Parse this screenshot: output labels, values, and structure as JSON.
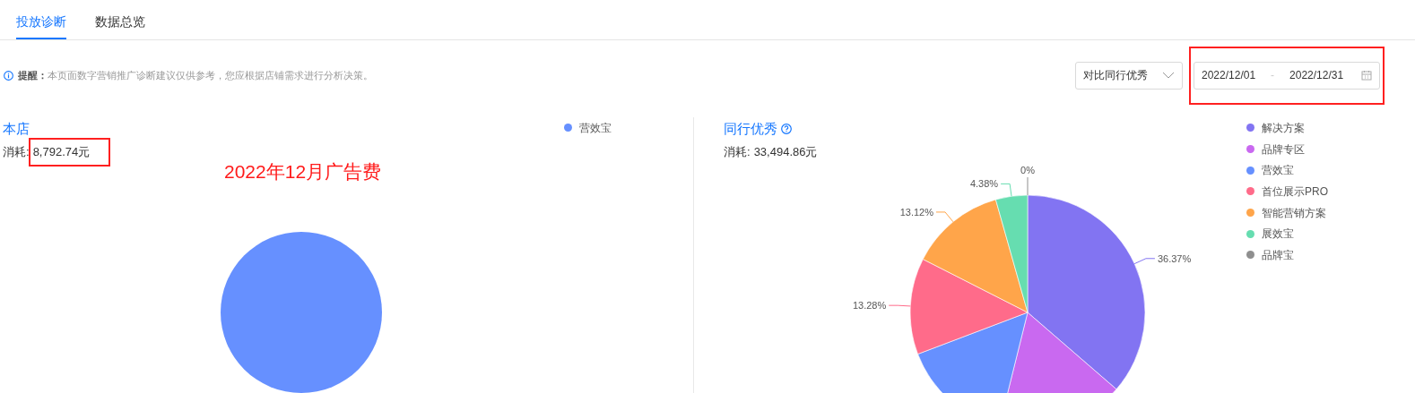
{
  "tabs": [
    {
      "label": "投放诊断",
      "selected": true
    },
    {
      "label": "数据总览",
      "selected": false
    }
  ],
  "notice": {
    "label": "提醒：",
    "text": "本页面数字营销推广诊断建议仅供参考，您应根据店铺需求进行分析决策。"
  },
  "compare_select": {
    "value": "对比同行优秀"
  },
  "date_range": {
    "start": "2022/12/01",
    "separator": "-",
    "end": "2022/12/31",
    "highlighted": true
  },
  "panels": [
    {
      "title": "本店",
      "spend": {
        "label": "消耗:",
        "value": "8,792.74元",
        "highlighted": true
      },
      "annotation": "2022年12月广告费",
      "chart_data": {
        "type": "pie",
        "categories": [
          "营效宝"
        ],
        "series": [
          {
            "color": "#6690ff",
            "values": [
              100
            ]
          }
        ]
      }
    },
    {
      "title": "同行优秀",
      "help_icon": true,
      "spend": {
        "label": "消耗:",
        "value": "33,494.86元"
      },
      "chart_data": {
        "type": "pie",
        "categories": [
          "解决方案",
          "品牌专区",
          "营效宝",
          "首位展示PRO",
          "智能营销方案",
          "展效宝",
          "品牌宝"
        ],
        "series": [
          {
            "colors": [
              "#8274f2",
              "#c969f0",
              "#6690ff",
              "#ff6b8a",
              "#ffa54a",
              "#66ddb0",
              "#8f8f8f"
            ],
            "values": [
              36.37,
              17.5,
              15.35,
              13.28,
              13.12,
              4.38,
              0
            ]
          }
        ],
        "value_labels": [
          "36.37%",
          null,
          null,
          "13.28%",
          "13.12%",
          "4.38%",
          "0%"
        ]
      }
    }
  ]
}
